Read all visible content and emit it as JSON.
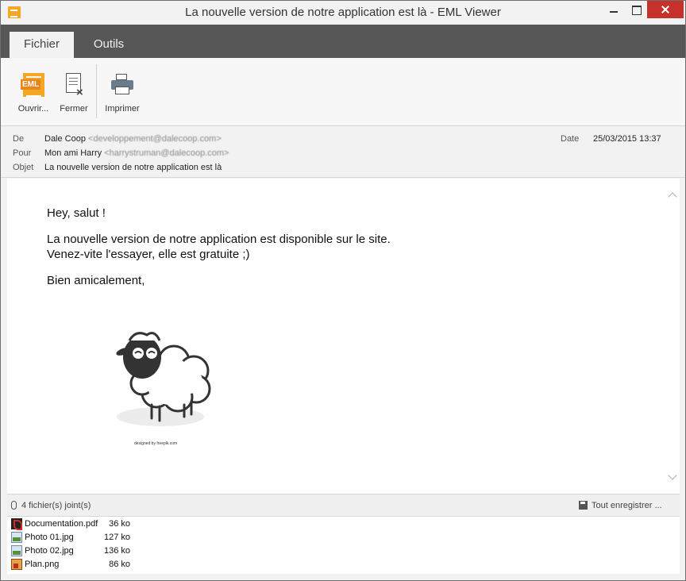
{
  "window": {
    "title": "La nouvelle version de notre application est là - EML Viewer"
  },
  "tabs": [
    {
      "label": "Fichier",
      "active": true
    },
    {
      "label": "Outils",
      "active": false
    }
  ],
  "ribbon": {
    "open_label": "Ouvrir...",
    "open_badge": "EML",
    "close_label": "Fermer",
    "print_label": "Imprimer"
  },
  "headers": {
    "from_label": "De",
    "from_name": "Dale Coop",
    "from_email": "<developpement@dalecoop.com>",
    "to_label": "Pour",
    "to_name": "Mon ami Harry",
    "to_email": "<harrystruman@dalecoop.com>",
    "subject_label": "Objet",
    "subject": "La nouvelle version de notre application est là",
    "date_label": "Date",
    "date": "25/03/2015 13:37"
  },
  "message": {
    "greeting": "Hey, salut !",
    "line1": "La nouvelle version de notre application est disponible sur le site.",
    "line2": "Venez-vite l'essayer, elle est gratuite ;)",
    "closing": "Bien amicalement,",
    "image_credit": "designed by freepik.com"
  },
  "attachments": {
    "count_label": "4 fichier(s) joint(s)",
    "save_all_label": "Tout enregistrer ...",
    "files": [
      {
        "name": "Documentation.pdf",
        "size": "36 ko",
        "icon": "pdf-icon"
      },
      {
        "name": "Photo 01.jpg",
        "size": "127 ko",
        "icon": "image-icon"
      },
      {
        "name": "Photo 02.jpg",
        "size": "136 ko",
        "icon": "image-icon"
      },
      {
        "name": "Plan.png",
        "size": "86 ko",
        "icon": "png-icon"
      }
    ]
  },
  "colors": {
    "accent": "#f5a623",
    "close_button": "#c7312b",
    "tabbar": "#575757"
  }
}
